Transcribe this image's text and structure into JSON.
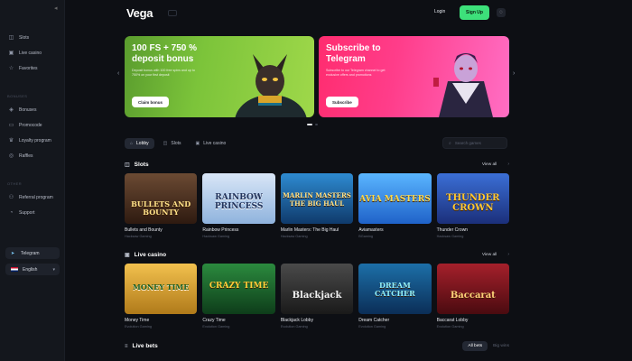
{
  "brand": {
    "logo": "Vega"
  },
  "header": {
    "login_label": "Login",
    "signup_label": "Sign Up"
  },
  "sidebar": {
    "groups": [
      {
        "heading": "",
        "items": [
          {
            "label": "Slots",
            "icon": "slot-icon"
          },
          {
            "label": "Live casino",
            "icon": "cards-icon"
          },
          {
            "label": "Favorites",
            "icon": "star-icon"
          }
        ]
      },
      {
        "heading": "Bonuses",
        "items": [
          {
            "label": "Bonuses",
            "icon": "gift-icon"
          },
          {
            "label": "Promocode",
            "icon": "ticket-icon"
          },
          {
            "label": "Loyalty program",
            "icon": "crown-icon"
          },
          {
            "label": "Raffles",
            "icon": "trophy-icon"
          }
        ]
      },
      {
        "heading": "Other",
        "items": [
          {
            "label": "Referral program",
            "icon": "users-icon"
          },
          {
            "label": "Support",
            "icon": "support-icon"
          }
        ]
      }
    ],
    "telegram_label": "Telegram",
    "language_label": "English"
  },
  "banners": [
    {
      "title": "100 FS + 750 % deposit bonus",
      "text": "Deposit bonus with 100 free spins and up to 750% on your first deposit",
      "button": "Claim bonus",
      "color": "#7cc43a"
    },
    {
      "title": "Subscribe to Telegram",
      "text": "Subscribe to our Telegram channel to get exclusive offers and promotions",
      "button": "Subscribe",
      "color": "#ff3d8a"
    }
  ],
  "tabs": [
    {
      "label": "Lobby",
      "icon": "home-icon",
      "active": true
    },
    {
      "label": "Slots",
      "icon": "slot-icon",
      "active": false
    },
    {
      "label": "Live casino",
      "icon": "cards-icon",
      "active": false
    }
  ],
  "search": {
    "placeholder": "Search games"
  },
  "slots": {
    "title": "Slots",
    "view_all": "View all",
    "games": [
      {
        "name": "Bullets and Bounty",
        "provider": "Hacksaw Gaming",
        "art": "BULLETS AND BOUNTY"
      },
      {
        "name": "Rainbow Princess",
        "provider": "Hacksaw Gaming",
        "art": "RAINBOW PRINCESS"
      },
      {
        "name": "Marlin Masters: The Big Haul",
        "provider": "Hacksaw Gaming",
        "art": "MARLIN MASTERS THE BIG HAUL"
      },
      {
        "name": "Aviamasters",
        "provider": "BGaming",
        "art": "AVIA MASTERS"
      },
      {
        "name": "Thunder Crown",
        "provider": "Hacksaw Gaming",
        "art": "THUNDER CROWN"
      }
    ]
  },
  "live_casino": {
    "title": "Live casino",
    "view_all": "View all",
    "games": [
      {
        "name": "Money Time",
        "provider": "Evolution Gaming",
        "art": "MONEY TIME"
      },
      {
        "name": "Crazy Time",
        "provider": "Evolution Gaming",
        "art": "CRAZY TIME"
      },
      {
        "name": "Blackjack Lobby",
        "provider": "Evolution Gaming",
        "art": "Blackjack"
      },
      {
        "name": "Dream Catcher",
        "provider": "Evolution Gaming",
        "art": "DREAM CATCHER"
      },
      {
        "name": "Baccarat Lobby",
        "provider": "Evolution Gaming",
        "art": "Baccarat"
      }
    ]
  },
  "live_bets": {
    "title": "Live bets",
    "tab_all": "All bets",
    "tab_high": "Big wins"
  },
  "colors": {
    "accent": "#3de07a",
    "bg": "#0d0f14",
    "sidebar": "#14171d"
  }
}
